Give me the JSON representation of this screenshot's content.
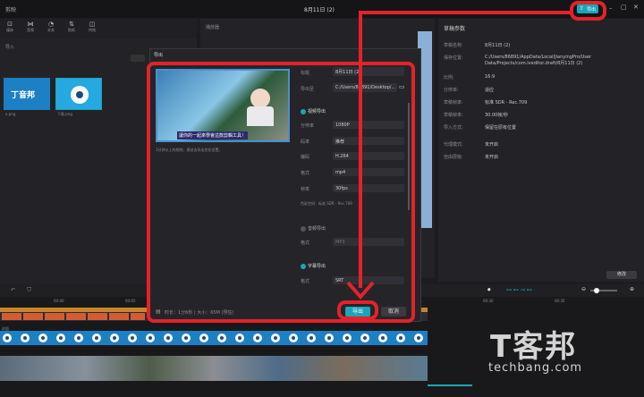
{
  "window": {
    "app_name": "剪映",
    "title": "8月11日 (2)"
  },
  "header_right": {
    "export_label": "导出"
  },
  "toolbar": {
    "items": [
      "媒体",
      "音频",
      "文本",
      "贴纸",
      "特效"
    ]
  },
  "media": {
    "search_label": "导入",
    "files": [
      {
        "name": "x.png"
      },
      {
        "name": "下载.png"
      }
    ]
  },
  "player": {
    "title": "播放器"
  },
  "draft": {
    "title": "草稿参数",
    "rows": [
      {
        "label": "草稿名称:",
        "value": "8月11日 (2)"
      },
      {
        "label": "保存位置:",
        "value": "C:/Users/86891/AppData/Local/JianyingPro/User Data/Projects/com.lveditor.draft/8月11日 (2)"
      },
      {
        "label": "比例:",
        "value": "16:9"
      },
      {
        "label": "分辨率:",
        "value": "适应"
      },
      {
        "label": "草稿帧率:",
        "value": "标准 SDR - Rec.709"
      },
      {
        "label": "草稿帧率:",
        "value": "30.00帧/秒"
      },
      {
        "label": "导入方式:",
        "value": "保留在原有位置"
      },
      {
        "label": "代理模式:",
        "value": "未开启"
      },
      {
        "label": "自由层级:",
        "value": "未开启"
      }
    ],
    "edit_button": "修改"
  },
  "dialog": {
    "title": "导出",
    "preview_caption": "讓你的一起來學會這款剪輯工具！",
    "preview_hint": "1分钟以上的视频，建议去导出优化设置。",
    "title_label": "标题",
    "title_value": "8月11日 (2)",
    "export_to_label": "导出至",
    "export_to_value": "C:/Users/86891/Desktop/...",
    "video_section": "视频导出",
    "resolution_label": "分辨率",
    "resolution_value": "1080P",
    "bitrate_label": "码率",
    "bitrate_value": "推荐",
    "codec_label": "编码",
    "codec_value": "H.264",
    "format_label": "格式",
    "format_value": "mp4",
    "fps_label": "帧率",
    "fps_value": "30fps",
    "color_note": "色彩空间：标准 SDR - Rec.709",
    "audio_section": "音频导出",
    "audio_format_label": "格式",
    "audio_format_value": "MP3",
    "subtitle_section": "字幕导出",
    "subtitle_format_label": "格式",
    "subtitle_format_value": "SRT",
    "footer_info": "时长：1分6秒 | 大小：65M (预估)",
    "export_button": "导出",
    "cancel_button": "取消"
  },
  "timeline": {
    "ruler": [
      "00:00",
      "00:05",
      "00:10",
      "00:15",
      "00:20",
      "00:25",
      "00:30",
      "00:35"
    ],
    "track_label": "封面"
  },
  "watermark": {
    "brand": "T客邦",
    "url": "techbang.com"
  },
  "colors": {
    "accent": "#1aa6b8",
    "annotation": "#e3222b",
    "background": "#1c1c1f"
  }
}
